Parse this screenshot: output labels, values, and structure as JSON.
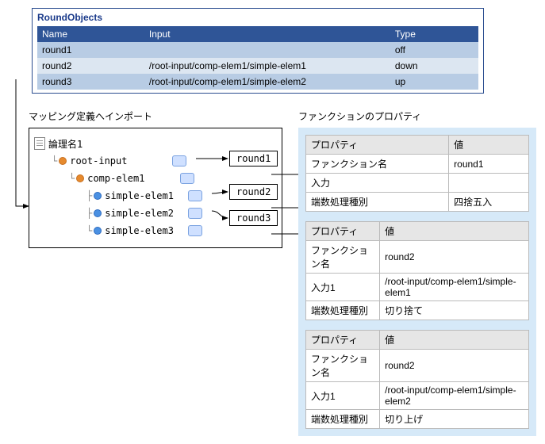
{
  "round_objects": {
    "title": "RoundObjects",
    "headers": {
      "name": "Name",
      "input": "Input",
      "type": "Type"
    },
    "rows": [
      {
        "name": "round1",
        "input": "",
        "type": "off"
      },
      {
        "name": "round2",
        "input": "/root-input/comp-elem1/simple-elem1",
        "type": "down"
      },
      {
        "name": "round3",
        "input": "/root-input/comp-elem1/simple-elem2",
        "type": "up"
      }
    ]
  },
  "mapping": {
    "section_label": "マッピング定義へインポート",
    "root_label": "論理名1",
    "tree": {
      "root": "root-input",
      "comp": "comp-elem1",
      "leaf1": "simple-elem1",
      "leaf2": "simple-elem2",
      "leaf3": "simple-elem3"
    },
    "funcs": {
      "r1": "round1",
      "r2": "round2",
      "r3": "round3"
    }
  },
  "properties": {
    "section_label": "ファンクションのプロパティ",
    "headers": {
      "prop": "プロパティ",
      "value": "値"
    },
    "blocks": [
      {
        "rows": [
          {
            "k": "ファンクション名",
            "v": "round1"
          },
          {
            "k": "入力",
            "v": ""
          },
          {
            "k": "端数処理種別",
            "v": "四捨五入"
          }
        ]
      },
      {
        "rows": [
          {
            "k": "ファンクション名",
            "v": "round2"
          },
          {
            "k": "入力1",
            "v": "/root-input/comp-elem1/simple-elem1"
          },
          {
            "k": "端数処理種別",
            "v": "切り捨て"
          }
        ]
      },
      {
        "rows": [
          {
            "k": "ファンクション名",
            "v": "round2"
          },
          {
            "k": "入力1",
            "v": "/root-input/comp-elem1/simple-elem2"
          },
          {
            "k": "端数処理種別",
            "v": "切り上げ"
          }
        ]
      }
    ]
  }
}
